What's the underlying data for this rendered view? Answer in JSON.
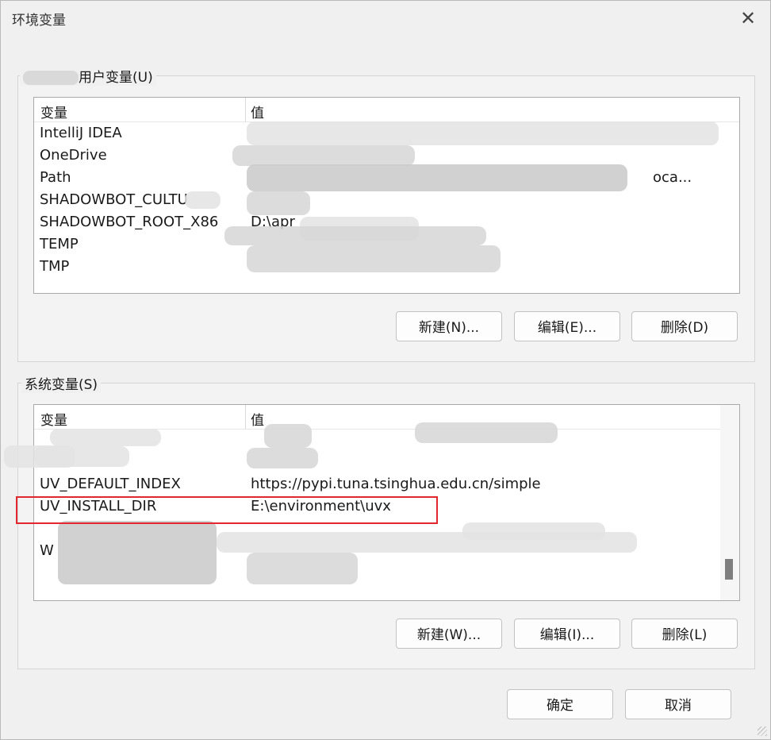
{
  "window": {
    "title": "环境变量",
    "close_label": "✕"
  },
  "user_vars": {
    "group_label": "用户变量(U)",
    "header": {
      "name": "变量",
      "value": "值"
    },
    "rows": [
      {
        "name": "IntelliJ IDEA",
        "value": ""
      },
      {
        "name": "OneDrive",
        "value": ""
      },
      {
        "name": "Path",
        "value": "oca..."
      },
      {
        "name": "SHADOWBOT_CULTU",
        "value": ""
      },
      {
        "name": "SHADOWBOT_ROOT_X86",
        "value": "D:\\apr"
      },
      {
        "name": "TEMP",
        "value": ""
      },
      {
        "name": "TMP",
        "value": ""
      }
    ],
    "buttons": {
      "new": "新建(N)...",
      "edit": "编辑(E)...",
      "delete": "删除(D)"
    }
  },
  "system_vars": {
    "group_label": "系统变量(S)",
    "header": {
      "name": "变量",
      "value": "值"
    },
    "rows": [
      {
        "name": "UV_DEFAULT_INDEX",
        "value": "https://pypi.tuna.tsinghua.edu.cn/simple"
      },
      {
        "name": "UV_INSTALL_DIR",
        "value": "E:\\environment\\uvx"
      },
      {
        "name": "W",
        "value": ""
      }
    ],
    "buttons": {
      "new": "新建(W)...",
      "edit": "编辑(I)...",
      "delete": "删除(L)"
    }
  },
  "footer": {
    "ok": "确定",
    "cancel": "取消"
  },
  "colors": {
    "highlight": "#e0282e",
    "background": "#f0f0f0"
  },
  "icons": {
    "close": "close-icon"
  }
}
